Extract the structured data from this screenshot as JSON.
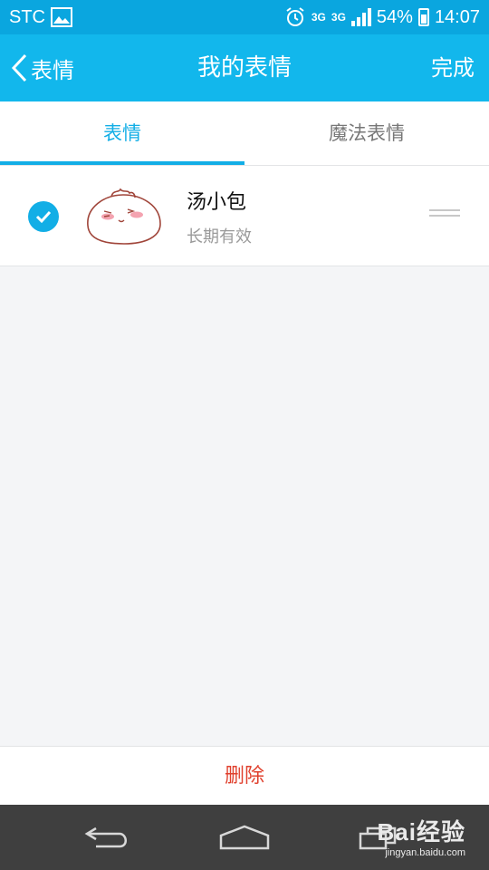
{
  "status_bar": {
    "carrier": "STC",
    "network_1": "3G",
    "network_2": "3G",
    "battery": "54%",
    "time": "14:07"
  },
  "header": {
    "back_label": "表情",
    "title": "我的表情",
    "done_label": "完成"
  },
  "tabs": [
    {
      "label": "表情",
      "active": true
    },
    {
      "label": "魔法表情",
      "active": false
    }
  ],
  "items": [
    {
      "name": "汤小包",
      "validity": "长期有效",
      "checked": true,
      "thumbnail": "dumpling-sticker"
    }
  ],
  "footer": {
    "delete_label": "删除"
  },
  "watermark": {
    "brand": "Bai经验",
    "url": "jingyan.baidu.com"
  },
  "colors": {
    "accent": "#12b7ec",
    "delete": "#e0402d",
    "navbar": "#3f3f3f"
  }
}
